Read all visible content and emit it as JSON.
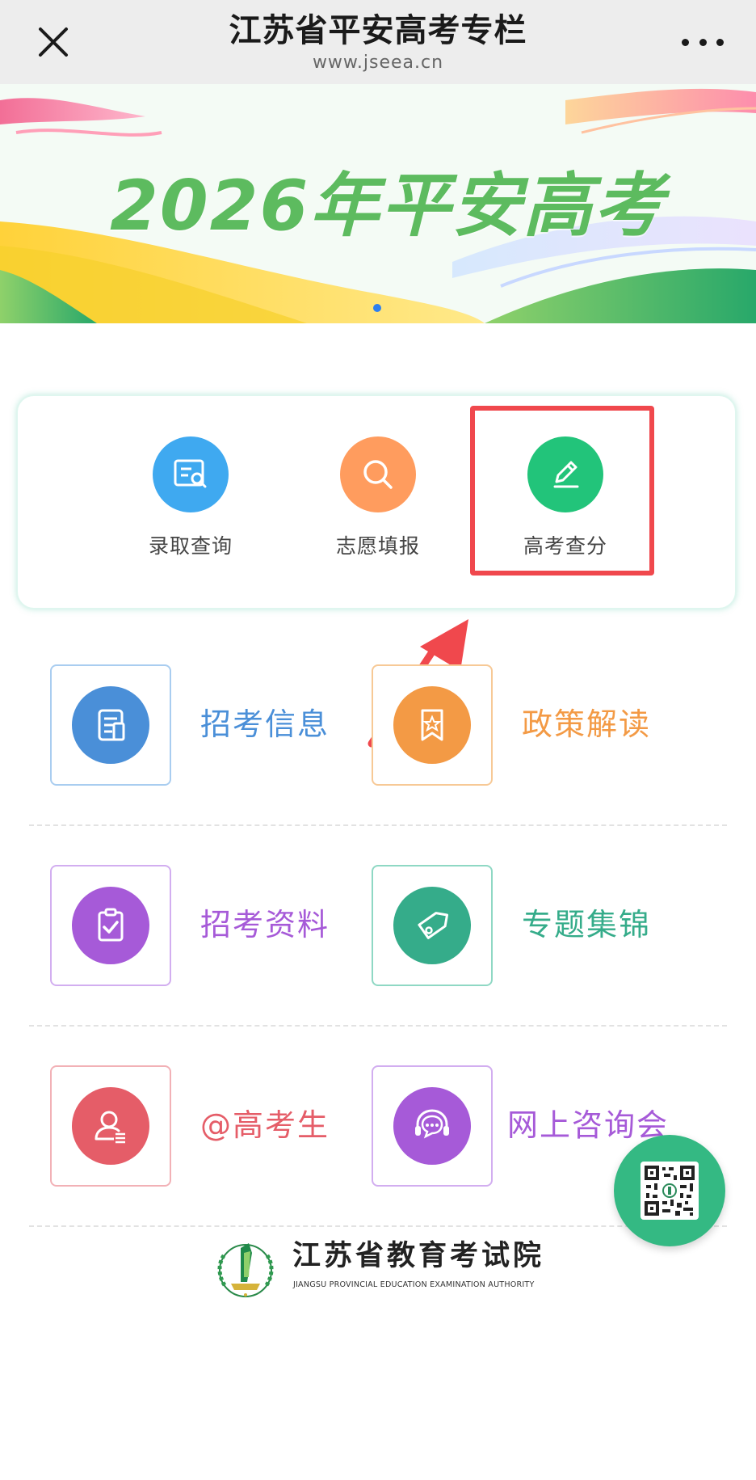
{
  "topbar": {
    "title": "江苏省平安高考专栏",
    "subtitle": "www.jseea.cn"
  },
  "banner": {
    "title": "2026年平安高考"
  },
  "quick_actions": [
    {
      "label": "录取查询",
      "icon": "search-document-icon",
      "color": "#3fa9f0"
    },
    {
      "label": "志愿填报",
      "icon": "magnifier-icon",
      "color": "#ff9c5e"
    },
    {
      "label": "高考查分",
      "icon": "pencil-icon",
      "color": "#22c47a"
    }
  ],
  "tiles": [
    {
      "label": "招考信息",
      "icon": "document-icon",
      "color": "#4a8fd8",
      "border": "#a9cdf0"
    },
    {
      "label": "政策解读",
      "icon": "bookmark-star-icon",
      "color": "#f39a45",
      "border": "#f7c996"
    },
    {
      "label": "招考资料",
      "icon": "clipboard-check-icon",
      "color": "#a65ad8",
      "border": "#d2aef0"
    },
    {
      "label": "专题集锦",
      "icon": "tag-icon",
      "color": "#35ac8a",
      "border": "#8fd8c4"
    },
    {
      "label": "@高考生",
      "icon": "user-icon",
      "color": "#e55d68",
      "border": "#f2b1b6"
    },
    {
      "label": "网上咨询会",
      "icon": "headset-chat-icon",
      "color": "#a65ad8",
      "border": "#d2aef0"
    }
  ],
  "footer": {
    "name": "江苏省教育考试院",
    "name_en": "JIANGSU PROVINCIAL EDUCATION EXAMINATION AUTHORITY"
  },
  "colors": {
    "accent_green": "#34b983",
    "highlight_red": "#f0484d",
    "topbar_bg": "#ededed"
  }
}
